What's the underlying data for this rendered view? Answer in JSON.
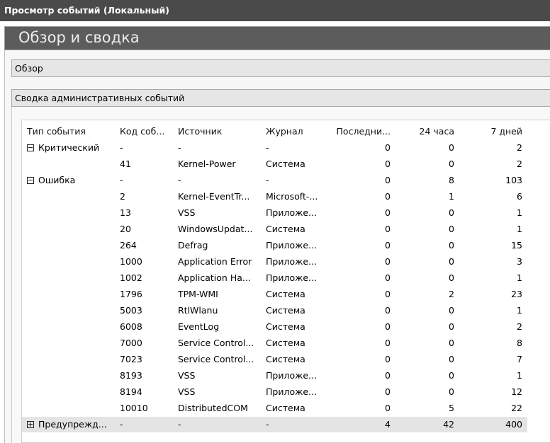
{
  "window": {
    "title": "Просмотр событий (Локальный)"
  },
  "page": {
    "heading": "Обзор и сводка"
  },
  "sections": {
    "overview": "Обзор",
    "admin_summary": "Сводка административных событий"
  },
  "table": {
    "columns": [
      "Тип события",
      "Код соб...",
      "Источник",
      "Журнал",
      "Последни...",
      "24 часа",
      "7 дней"
    ],
    "rows": [
      {
        "type": "Критический",
        "expander": "minus",
        "code": "-",
        "source": "-",
        "log": "-",
        "last": "0",
        "h24": "0",
        "d7": "2"
      },
      {
        "type": "",
        "code": "41",
        "source": "Kernel-Power",
        "log": "Система",
        "last": "0",
        "h24": "0",
        "d7": "2"
      },
      {
        "type": "Ошибка",
        "expander": "minus",
        "code": "-",
        "source": "-",
        "log": "-",
        "last": "0",
        "h24": "8",
        "d7": "103"
      },
      {
        "type": "",
        "code": "2",
        "source": "Kernel-EventTr...",
        "log": "Microsoft-...",
        "last": "0",
        "h24": "1",
        "d7": "6"
      },
      {
        "type": "",
        "code": "13",
        "source": "VSS",
        "log": "Приложе...",
        "last": "0",
        "h24": "0",
        "d7": "1"
      },
      {
        "type": "",
        "code": "20",
        "source": "WindowsUpdat...",
        "log": "Система",
        "last": "0",
        "h24": "0",
        "d7": "1"
      },
      {
        "type": "",
        "code": "264",
        "source": "Defrag",
        "log": "Приложе...",
        "last": "0",
        "h24": "0",
        "d7": "15"
      },
      {
        "type": "",
        "code": "1000",
        "source": "Application Error",
        "log": "Приложе...",
        "last": "0",
        "h24": "0",
        "d7": "3"
      },
      {
        "type": "",
        "code": "1002",
        "source": "Application Ha...",
        "log": "Приложе...",
        "last": "0",
        "h24": "0",
        "d7": "1"
      },
      {
        "type": "",
        "code": "1796",
        "source": "TPM-WMI",
        "log": "Система",
        "last": "0",
        "h24": "2",
        "d7": "23"
      },
      {
        "type": "",
        "code": "5003",
        "source": "RtlWlanu",
        "log": "Система",
        "last": "0",
        "h24": "0",
        "d7": "1"
      },
      {
        "type": "",
        "code": "6008",
        "source": "EventLog",
        "log": "Система",
        "last": "0",
        "h24": "0",
        "d7": "2"
      },
      {
        "type": "",
        "code": "7000",
        "source": "Service Control...",
        "log": "Система",
        "last": "0",
        "h24": "0",
        "d7": "8"
      },
      {
        "type": "",
        "code": "7023",
        "source": "Service Control...",
        "log": "Система",
        "last": "0",
        "h24": "0",
        "d7": "7"
      },
      {
        "type": "",
        "code": "8193",
        "source": "VSS",
        "log": "Приложе...",
        "last": "0",
        "h24": "0",
        "d7": "1"
      },
      {
        "type": "",
        "code": "8194",
        "source": "VSS",
        "log": "Приложе...",
        "last": "0",
        "h24": "0",
        "d7": "12"
      },
      {
        "type": "",
        "code": "10010",
        "source": "DistributedCOM",
        "log": "Система",
        "last": "0",
        "h24": "5",
        "d7": "22"
      },
      {
        "type": "Предупрежд...",
        "expander": "plus",
        "selected": true,
        "code": "-",
        "source": "-",
        "log": "-",
        "last": "4",
        "h24": "42",
        "d7": "400"
      }
    ]
  }
}
